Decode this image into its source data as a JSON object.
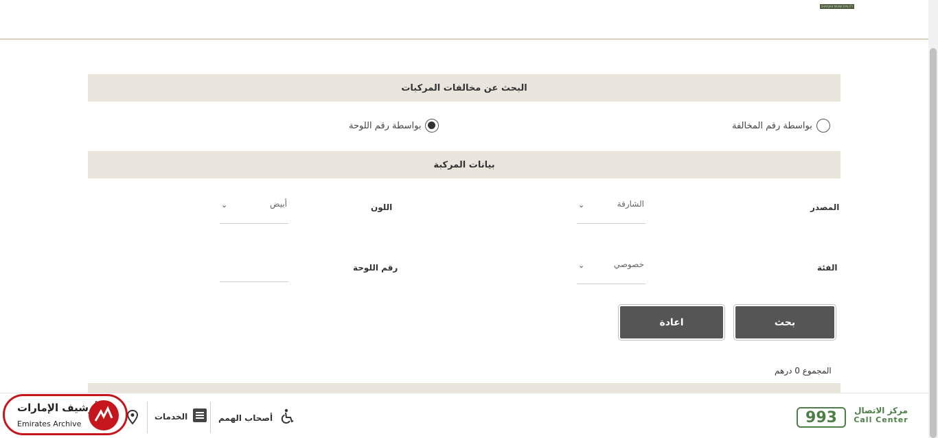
{
  "header": {
    "logo_text": "SHARJAH MUNICIPALITY"
  },
  "search_section": {
    "title": "البحث عن مخالفات المركبات",
    "options": [
      {
        "label": "بواسطة رقم المخالفة",
        "checked": false
      },
      {
        "label": "بواسطة رقم اللوحة",
        "checked": true
      }
    ]
  },
  "vehicle_section": {
    "title": "بيانات المركبة",
    "fields": {
      "source": {
        "label": "المصدر",
        "value": "الشارقة"
      },
      "color": {
        "label": "اللون",
        "value": "أبيض"
      },
      "category": {
        "label": "الفئة",
        "value": "خصوصي"
      },
      "plate_number": {
        "label": "رقم اللوحة",
        "value": ""
      }
    }
  },
  "actions": {
    "search_label": "بحث",
    "reset_label": "اعادة"
  },
  "total_text": "المجموع 0 درهم",
  "footer": {
    "call_center": {
      "number": "993",
      "arabic": "مركز الاتصال",
      "english": "Call Center"
    },
    "people_of_determination": "أصحاب الهمم",
    "services": "الخدمات"
  },
  "archive_badge": {
    "arabic": "أرشيف الإمارات",
    "english": "Emirates Archive"
  },
  "colors": {
    "section_bg": "#e9e5dd",
    "button_bg": "#555555",
    "brand_green": "#4b7f45",
    "badge_red": "#c4161c"
  }
}
